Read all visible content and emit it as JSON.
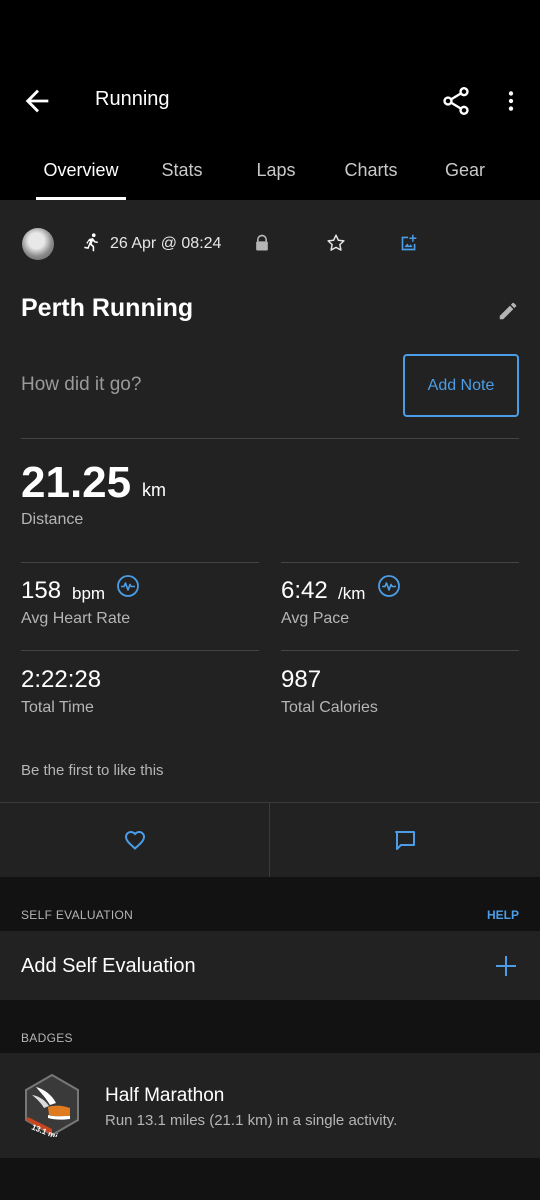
{
  "header": {
    "title": "Running"
  },
  "tabs": [
    {
      "label": "Overview",
      "active": true
    },
    {
      "label": "Stats",
      "active": false
    },
    {
      "label": "Laps",
      "active": false
    },
    {
      "label": "Charts",
      "active": false
    },
    {
      "label": "Gear",
      "active": false
    }
  ],
  "activity": {
    "date": "26 Apr @ 08:24",
    "name": "Perth Running",
    "prompt": "How did it go?",
    "add_note_label": "Add Note",
    "distance": {
      "value": "21.25",
      "unit": "km",
      "label": "Distance"
    },
    "stats": {
      "heart_rate": {
        "value": "158",
        "unit": "bpm",
        "label": "Avg Heart Rate"
      },
      "pace": {
        "value": "6:42",
        "unit": "/km",
        "label": "Avg Pace"
      },
      "total_time": {
        "value": "2:22:28",
        "label": "Total Time"
      },
      "calories": {
        "value": "987",
        "label": "Total Calories"
      }
    },
    "likes_text": "Be the first to like this"
  },
  "self_evaluation": {
    "header": "SELF EVALUATION",
    "help_label": "HELP",
    "add_label": "Add Self Evaluation"
  },
  "badges": {
    "header": "BADGES",
    "items": [
      {
        "title": "Half Marathon",
        "description": "Run 13.1 miles (21.1 km) in a single activity.",
        "badge_text": "13.1 mi"
      }
    ]
  },
  "icons": {
    "back": "arrow-left-icon",
    "share": "share-icon",
    "more": "more-vertical-icon",
    "run": "running-person-icon",
    "lock": "lock-icon",
    "star": "star-icon",
    "photo": "add-photo-icon",
    "edit": "pencil-icon",
    "pulse": "heart-rate-pulse-icon",
    "like": "heart-icon",
    "comment": "comment-icon",
    "add": "plus-icon"
  },
  "colors": {
    "accent": "#4a9de6",
    "background": "#121212",
    "card": "#222222",
    "topbar": "#000000"
  }
}
